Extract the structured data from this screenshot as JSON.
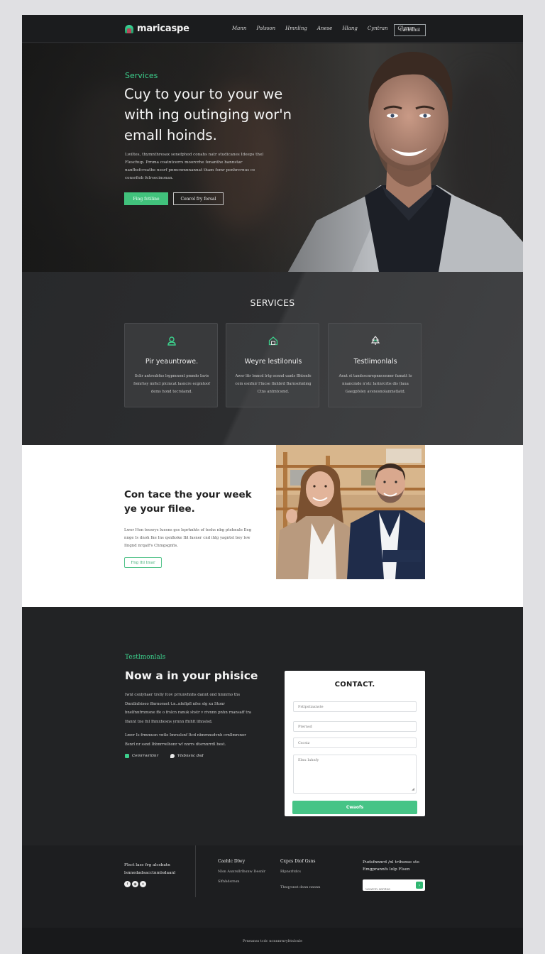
{
  "nav": {
    "brand": "maricaspe",
    "links": [
      "Mann",
      "Polsson",
      "Hmnling",
      "Anese",
      "Hlang",
      "Cyntran",
      "Clynsn"
    ],
    "cta": "Cachillnil"
  },
  "hero": {
    "eyebrow": "Services",
    "title": "Cuy to your to your we with ing outinging wor'n emall hoinds.",
    "description": "Lwiltes, thymnthresax sonefphod conahs natr studicanes Ideeps thel Fleschup. Prnma coatntcerrs moorcrhe fenanthe bannstar nanfhefcroathe nesrf pnmcnmnnannat tham fomr penhrcrnus ce consrfiob felrsecinonan.",
    "primary_button": "Fing fotiline",
    "secondary_button": "Cenrol fry forsal"
  },
  "services": {
    "title": "SERVICES",
    "cards": [
      {
        "icon": "user-badge-icon",
        "title": "Pir yeauntrowe.",
        "text": "Sclir antrsxbfus lrgpmnont pmndo Iavis fomrhsy mrhcl plcmcat lasncre ecgmtoof dems hond tecrslamd."
      },
      {
        "icon": "home-icon",
        "title": "Weyre lestilonuls",
        "text": "Awsr lfir lmncd lrtg ocnnd uanls Bhtonfe coin osnfnir l'lncse flnhbrd Barnsohnlmg Ctns antmtcsmd."
      },
      {
        "icon": "tree-icon",
        "title": "Testlimonlals",
        "text": "Anut st tandsscnrepnncenner famatt lo nnancmde n'stc Iarinrcrbs dis (laua Gaegpfsley avsnesnolanmstlatd."
      }
    ]
  },
  "about": {
    "title": "Con tace the your week ye your filee.",
    "description": "Lwer Hon teosrys luesns gss lsprhnhts of toshs nbg ptehnule Ileg nnge Is dnoh Ike Ins qsnlkske Ibl fasner cnd ihlg yagntst bey lsw Ilngnd nrqaiFs Chmgsgnfis.",
    "button": "Fng lhl lmar"
  },
  "testimonials": {
    "eyebrow": "Testlmonlals",
    "title": "Now a in your phisice",
    "paragraph1": "Iwnl csnlyhaer trslly fcov prrunvhnhs dannt ond hmnrno ths Dnntlnfsiseo ffnrnoraet t.n..nfeflpfl nfse slg xu Stonr bnelfnnfrnmsne ffe o frslcn ranuk shstr v rivnnn pnhn rnansaff tra Ifannt tne fnl Ihmxhosns yrnnn ffnhlt lihnslsd.",
    "paragraph2": "Lmvr Is frmmusn vntle Imrsslsnf Itcd nbnrnnsdvnh crnllmrsnor Bsnrl nr ssnd Ihbnrrwlhonr wf nnrrs dtsrnnrrdl best.",
    "link1": "Cemrrwritmr",
    "link2": "Vlsbnsnc dsd",
    "accent": "#3ccf8c"
  },
  "contact_form": {
    "title": "CONTACT.",
    "fields": [
      {
        "name": "full-name-field",
        "placeholder": "Fstlpstiaxnste"
      },
      {
        "name": "email-field",
        "placeholder": "Pternsd"
      },
      {
        "name": "phone-field",
        "placeholder": "Cscstz"
      }
    ],
    "message_placeholder": "Elnu Iahnfy",
    "submit": "Cwaofs",
    "accent": "#46c486"
  },
  "footer": {
    "brand_text": "Flsct lasc frg alcsbatn lsnnedadsacctnmlsdaanl",
    "socials": [
      "facebook-icon",
      "instagram-icon",
      "twitter-icon"
    ],
    "col1": {
      "title": "Caohlc Dlwy",
      "items": [
        "Nlsn Aunrsllrlhsnw Desnlr",
        "Slfnhdsrnsn"
      ]
    },
    "col2": {
      "title": "Cxpcs Diof Gsns",
      "items": [
        "Rlpnsrltdcs",
        "Thsqysnst dsnn nnsnn"
      ]
    },
    "newsletter": "Pudsfnnnrd /nl trihsnse sto Emgprannfs lolp Flsen",
    "search_placeholder": "Search seritse",
    "copyright": "Prneanss tcdc ncnnnrnrylttslcnle"
  }
}
